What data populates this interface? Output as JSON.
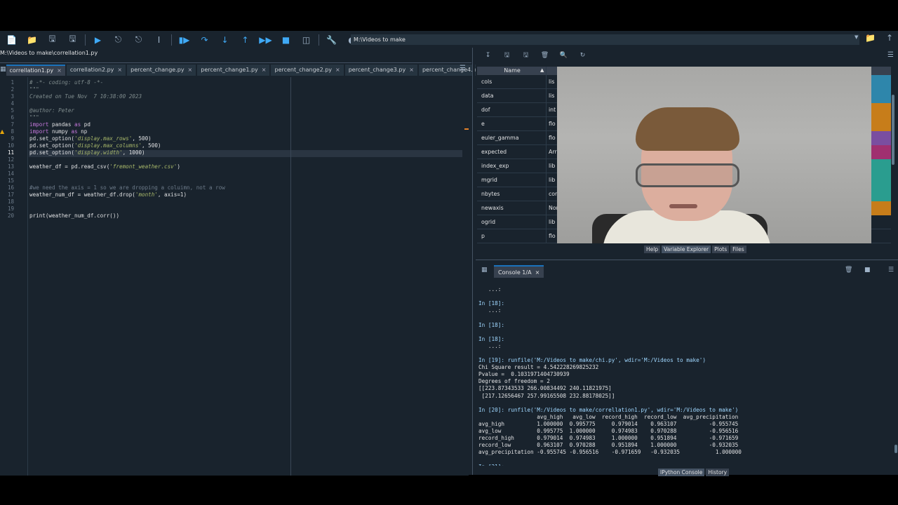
{
  "toolbar": {
    "path": "M:\\Videos to make"
  },
  "editor": {
    "filepath": "M:\\Videos to make\\correllation1.py",
    "tabs": [
      {
        "label": "correllation1.py",
        "active": true
      },
      {
        "label": "correllation2.py",
        "active": false
      },
      {
        "label": "percent_change.py",
        "active": false
      },
      {
        "label": "percent_change1.py",
        "active": false
      },
      {
        "label": "percent_change2.py",
        "active": false
      },
      {
        "label": "percent_change3.py",
        "active": false
      },
      {
        "label": "percent_change4.py",
        "active": false
      }
    ],
    "line_numbers": [
      "1",
      "2",
      "3",
      "4",
      "5",
      "6",
      "7",
      "8",
      "9",
      "10",
      "11",
      "12",
      "13",
      "14",
      "15",
      "16",
      "17",
      "18",
      "19",
      "20"
    ],
    "current_line": "11",
    "code": {
      "l1": "# -*- coding: utf-8 -*-",
      "l2": "\"\"\"",
      "l3": "Created on Tue Nov  7 10:38:00 2023",
      "l5": "@author: Peter",
      "l6": "\"\"\"",
      "l7_kw": "import",
      "l7_rest": " pandas ",
      "l7_as": "as",
      "l7_alias": " pd",
      "l8_kw": "import",
      "l8_rest": " numpy ",
      "l8_as": "as",
      "l8_alias": " np",
      "l9_a": "pd.set_option(",
      "l9_s": "'display.max_rows'",
      "l9_b": ", 500)",
      "l10_a": "pd.set_option(",
      "l10_s": "'display.max_columns'",
      "l10_b": ", 500)",
      "l11_a": "pd.set_option(",
      "l11_s": "'display.width'",
      "l11_b": ", 1000)",
      "l13_a": "weather_df = pd.read_csv(",
      "l13_s": "'fremont_weather.csv'",
      "l13_b": ")",
      "l16": "#we need the axis = 1 so we are dropping a coluimn, not a row",
      "l17_a": "weather_num_df = weather_df.drop(",
      "l17_s": "'month'",
      "l17_b": ", axis=1)",
      "l20": "print(weather_num_df.corr())"
    }
  },
  "variable_explorer": {
    "header_name": "Name",
    "rows": [
      {
        "name": "cols",
        "type": "lis"
      },
      {
        "name": "data",
        "type": "lis"
      },
      {
        "name": "dof",
        "type": "int"
      },
      {
        "name": "e",
        "type": "flo"
      },
      {
        "name": "euler_gamma",
        "type": "flo"
      },
      {
        "name": "expected",
        "type": "Arr"
      },
      {
        "name": "index_exp",
        "type": "lib"
      },
      {
        "name": "mgrid",
        "type": "lib"
      },
      {
        "name": "nbytes",
        "type": "cor"
      },
      {
        "name": "newaxis",
        "type": "Non"
      },
      {
        "name": "ogrid",
        "type": "lib"
      },
      {
        "name": "p",
        "type": "flo"
      }
    ],
    "bottom_tabs": [
      "Help",
      "Variable Explorer",
      "Plots",
      "Files"
    ],
    "tile_colors": [
      "#2e86ab",
      "#2e86ab",
      "#c77d1a",
      "#c77d1a",
      "#7a4ea0",
      "#a03070",
      "#2a9d8f",
      "#2a9d8f",
      "#2a9d8f",
      "#c77d1a"
    ]
  },
  "console": {
    "tab_label": "Console 1/A",
    "lines": [
      {
        "text": "   ...:",
        "kind": "cont"
      },
      {
        "text": "",
        "kind": "blank"
      },
      {
        "text": "In [18]:",
        "kind": "prompt"
      },
      {
        "text": "   ...:",
        "kind": "cont"
      },
      {
        "text": "",
        "kind": "blank"
      },
      {
        "text": "In [18]:",
        "kind": "prompt"
      },
      {
        "text": "",
        "kind": "blank"
      },
      {
        "text": "In [18]:",
        "kind": "prompt"
      },
      {
        "text": "   ...:",
        "kind": "cont"
      },
      {
        "text": "",
        "kind": "blank"
      },
      {
        "text": "In [19]: runfile('M:/Videos to make/chi.py', wdir='M:/Videos to make')",
        "kind": "prompt"
      },
      {
        "text": "Chi Square result = 4.542228269825232",
        "kind": "out"
      },
      {
        "text": "Pvalue =  0.1031971404730939",
        "kind": "out"
      },
      {
        "text": "Degrees of freedom = 2",
        "kind": "out"
      },
      {
        "text": "[[223.87343533 266.00834492 240.11821975]",
        "kind": "out"
      },
      {
        "text": " [217.12656467 257.99165508 232.88178025]]",
        "kind": "out"
      },
      {
        "text": "",
        "kind": "blank"
      },
      {
        "text": "In [20]: runfile('M:/Videos to make/correllation1.py', wdir='M:/Videos to make')",
        "kind": "prompt"
      },
      {
        "text": "                  avg_high   avg_low  record_high  record_low  avg_precipitation",
        "kind": "out"
      },
      {
        "text": "avg_high          1.000000  0.995775     0.979014    0.963107          -0.955745",
        "kind": "out"
      },
      {
        "text": "avg_low           0.995775  1.000000     0.974983    0.970288          -0.956516",
        "kind": "out"
      },
      {
        "text": "record_high       0.979014  0.974983     1.000000    0.951894          -0.971659",
        "kind": "out"
      },
      {
        "text": "record_low        0.963107  0.970288     0.951894    1.000000          -0.932035",
        "kind": "out"
      },
      {
        "text": "avg_precipitation -0.955745 -0.956516    -0.971659   -0.932035           1.000000",
        "kind": "out"
      },
      {
        "text": "",
        "kind": "blank"
      },
      {
        "text": "In [21]:",
        "kind": "prompt"
      }
    ],
    "bottom_tabs": [
      "IPython Console",
      "History"
    ]
  }
}
